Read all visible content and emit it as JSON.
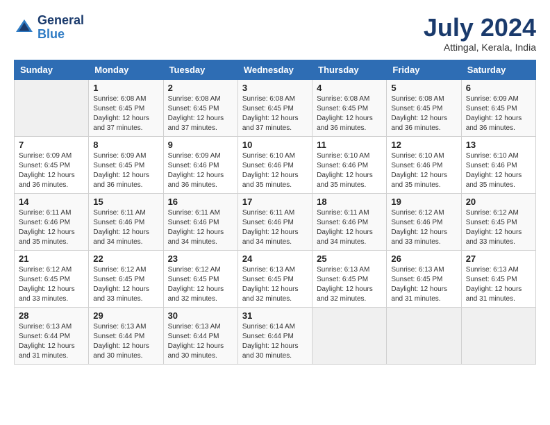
{
  "header": {
    "logo_line1": "General",
    "logo_line2": "Blue",
    "title": "July 2024",
    "location": "Attingal, Kerala, India"
  },
  "days_of_week": [
    "Sunday",
    "Monday",
    "Tuesday",
    "Wednesday",
    "Thursday",
    "Friday",
    "Saturday"
  ],
  "weeks": [
    [
      {
        "day": "",
        "info": ""
      },
      {
        "day": "1",
        "info": "Sunrise: 6:08 AM\nSunset: 6:45 PM\nDaylight: 12 hours\nand 37 minutes."
      },
      {
        "day": "2",
        "info": "Sunrise: 6:08 AM\nSunset: 6:45 PM\nDaylight: 12 hours\nand 37 minutes."
      },
      {
        "day": "3",
        "info": "Sunrise: 6:08 AM\nSunset: 6:45 PM\nDaylight: 12 hours\nand 37 minutes."
      },
      {
        "day": "4",
        "info": "Sunrise: 6:08 AM\nSunset: 6:45 PM\nDaylight: 12 hours\nand 36 minutes."
      },
      {
        "day": "5",
        "info": "Sunrise: 6:08 AM\nSunset: 6:45 PM\nDaylight: 12 hours\nand 36 minutes."
      },
      {
        "day": "6",
        "info": "Sunrise: 6:09 AM\nSunset: 6:45 PM\nDaylight: 12 hours\nand 36 minutes."
      }
    ],
    [
      {
        "day": "7",
        "info": "Sunrise: 6:09 AM\nSunset: 6:45 PM\nDaylight: 12 hours\nand 36 minutes."
      },
      {
        "day": "8",
        "info": "Sunrise: 6:09 AM\nSunset: 6:45 PM\nDaylight: 12 hours\nand 36 minutes."
      },
      {
        "day": "9",
        "info": "Sunrise: 6:09 AM\nSunset: 6:46 PM\nDaylight: 12 hours\nand 36 minutes."
      },
      {
        "day": "10",
        "info": "Sunrise: 6:10 AM\nSunset: 6:46 PM\nDaylight: 12 hours\nand 35 minutes."
      },
      {
        "day": "11",
        "info": "Sunrise: 6:10 AM\nSunset: 6:46 PM\nDaylight: 12 hours\nand 35 minutes."
      },
      {
        "day": "12",
        "info": "Sunrise: 6:10 AM\nSunset: 6:46 PM\nDaylight: 12 hours\nand 35 minutes."
      },
      {
        "day": "13",
        "info": "Sunrise: 6:10 AM\nSunset: 6:46 PM\nDaylight: 12 hours\nand 35 minutes."
      }
    ],
    [
      {
        "day": "14",
        "info": "Sunrise: 6:11 AM\nSunset: 6:46 PM\nDaylight: 12 hours\nand 35 minutes."
      },
      {
        "day": "15",
        "info": "Sunrise: 6:11 AM\nSunset: 6:46 PM\nDaylight: 12 hours\nand 34 minutes."
      },
      {
        "day": "16",
        "info": "Sunrise: 6:11 AM\nSunset: 6:46 PM\nDaylight: 12 hours\nand 34 minutes."
      },
      {
        "day": "17",
        "info": "Sunrise: 6:11 AM\nSunset: 6:46 PM\nDaylight: 12 hours\nand 34 minutes."
      },
      {
        "day": "18",
        "info": "Sunrise: 6:11 AM\nSunset: 6:46 PM\nDaylight: 12 hours\nand 34 minutes."
      },
      {
        "day": "19",
        "info": "Sunrise: 6:12 AM\nSunset: 6:46 PM\nDaylight: 12 hours\nand 33 minutes."
      },
      {
        "day": "20",
        "info": "Sunrise: 6:12 AM\nSunset: 6:45 PM\nDaylight: 12 hours\nand 33 minutes."
      }
    ],
    [
      {
        "day": "21",
        "info": "Sunrise: 6:12 AM\nSunset: 6:45 PM\nDaylight: 12 hours\nand 33 minutes."
      },
      {
        "day": "22",
        "info": "Sunrise: 6:12 AM\nSunset: 6:45 PM\nDaylight: 12 hours\nand 33 minutes."
      },
      {
        "day": "23",
        "info": "Sunrise: 6:12 AM\nSunset: 6:45 PM\nDaylight: 12 hours\nand 32 minutes."
      },
      {
        "day": "24",
        "info": "Sunrise: 6:13 AM\nSunset: 6:45 PM\nDaylight: 12 hours\nand 32 minutes."
      },
      {
        "day": "25",
        "info": "Sunrise: 6:13 AM\nSunset: 6:45 PM\nDaylight: 12 hours\nand 32 minutes."
      },
      {
        "day": "26",
        "info": "Sunrise: 6:13 AM\nSunset: 6:45 PM\nDaylight: 12 hours\nand 31 minutes."
      },
      {
        "day": "27",
        "info": "Sunrise: 6:13 AM\nSunset: 6:45 PM\nDaylight: 12 hours\nand 31 minutes."
      }
    ],
    [
      {
        "day": "28",
        "info": "Sunrise: 6:13 AM\nSunset: 6:44 PM\nDaylight: 12 hours\nand 31 minutes."
      },
      {
        "day": "29",
        "info": "Sunrise: 6:13 AM\nSunset: 6:44 PM\nDaylight: 12 hours\nand 30 minutes."
      },
      {
        "day": "30",
        "info": "Sunrise: 6:13 AM\nSunset: 6:44 PM\nDaylight: 12 hours\nand 30 minutes."
      },
      {
        "day": "31",
        "info": "Sunrise: 6:14 AM\nSunset: 6:44 PM\nDaylight: 12 hours\nand 30 minutes."
      },
      {
        "day": "",
        "info": ""
      },
      {
        "day": "",
        "info": ""
      },
      {
        "day": "",
        "info": ""
      }
    ]
  ]
}
